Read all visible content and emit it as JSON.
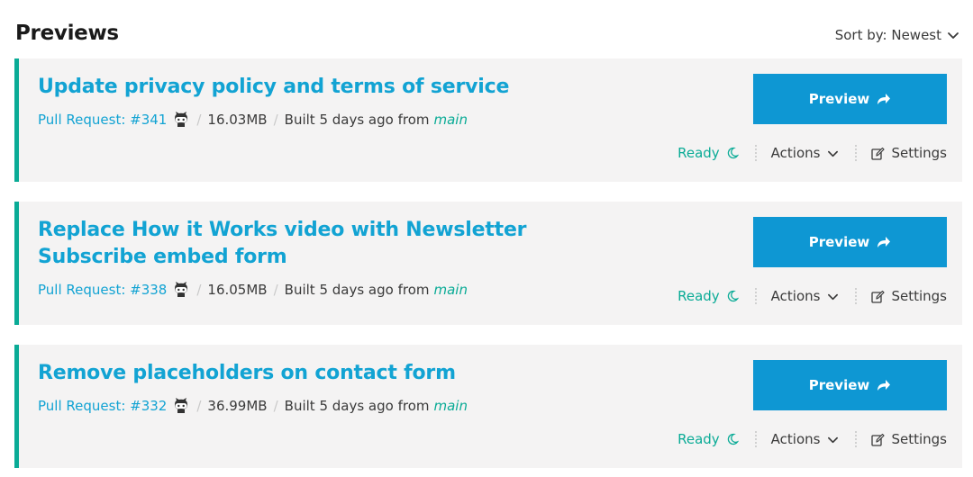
{
  "page": {
    "title": "Previews",
    "sort_label": "Sort by: Newest"
  },
  "colors": {
    "accent_teal": "#0aab96",
    "title_blue": "#12a3d3",
    "button_blue": "#0e97d3",
    "card_bg": "#f4f3f3"
  },
  "previews": [
    {
      "title": "Update privacy policy and terms of service",
      "pr_label": "Pull Request: #341",
      "size": "16.03MB",
      "built_text": "Built 5 days ago from",
      "branch": "main",
      "button_label": "Preview",
      "status": "Ready",
      "actions_label": "Actions",
      "settings_label": "Settings"
    },
    {
      "title": "Replace How it Works video with Newsletter Subscribe embed form",
      "pr_label": "Pull Request: #338",
      "size": "16.05MB",
      "built_text": "Built 5 days ago from",
      "branch": "main",
      "button_label": "Preview",
      "status": "Ready",
      "actions_label": "Actions",
      "settings_label": "Settings"
    },
    {
      "title": "Remove placeholders on contact form",
      "pr_label": "Pull Request: #332",
      "size": "36.99MB",
      "built_text": "Built 5 days ago from",
      "branch": "main",
      "button_label": "Preview",
      "status": "Ready",
      "actions_label": "Actions",
      "settings_label": "Settings"
    }
  ],
  "icons": {
    "sort": "chevron-down-icon",
    "repo": "github-icon",
    "preview": "share-arrow-icon",
    "status": "moon-icon",
    "actions": "chevron-down-icon",
    "settings": "edit-icon"
  }
}
